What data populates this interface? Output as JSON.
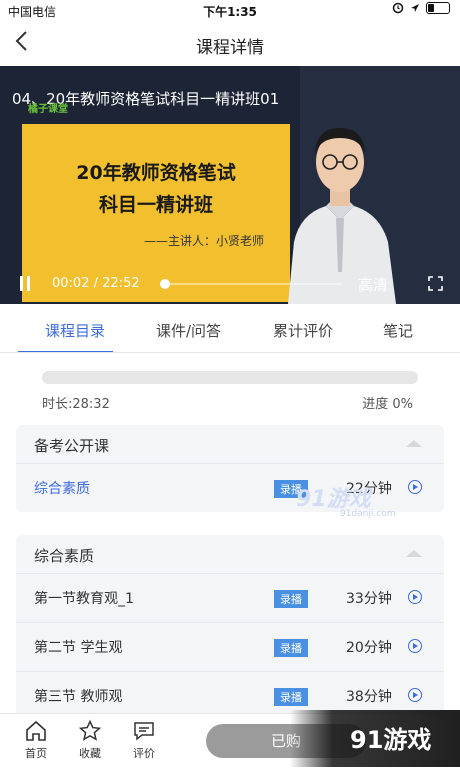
{
  "status_bar": {
    "carrier": "中国电信",
    "time": "下午1:35"
  },
  "nav": {
    "title": "课程详情"
  },
  "video": {
    "title": "04、20年教师资格笔试科目一精讲班01",
    "logo_text": "橘子课堂",
    "slide_line1": "20年教师资格笔试",
    "slide_line2": "科目一精讲班",
    "slide_speaker": "——主讲人：小贤老师",
    "current_time": "00:02",
    "separator": "/",
    "total_time": "22:52",
    "played_fraction": 0.015,
    "quality": "高清"
  },
  "tabs": [
    {
      "label": "课程目录",
      "active": true
    },
    {
      "label": "课件/问答"
    },
    {
      "label": "累计评价"
    },
    {
      "label": "笔记"
    }
  ],
  "progress": {
    "duration_text": "时长:28:32",
    "percent_text": "进度 0%",
    "value": 0
  },
  "sections": [
    {
      "name": "备考公开课",
      "rows": [
        {
          "title": "综合素质",
          "badge": "录播",
          "duration": "22分钟",
          "highlight": true
        }
      ]
    },
    {
      "name": "综合素质",
      "rows": [
        {
          "title": "第一节教育观_1",
          "badge": "录播",
          "duration": "33分钟"
        },
        {
          "title": "第二节 学生观",
          "badge": "录播",
          "duration": "20分钟"
        },
        {
          "title": "第三节 教师观",
          "badge": "录播",
          "duration": "38分钟"
        }
      ]
    }
  ],
  "watermark": {
    "main": "91游戏",
    "sub": "91danji.com",
    "bottom": "91游戏"
  },
  "bottom_nav": {
    "home": "首页",
    "favorite": "收藏",
    "review": "评价",
    "action_button": "已购"
  },
  "colors": {
    "accent": "#3d6ce0",
    "badge": "#4a90e2",
    "slide": "#f2c02f"
  }
}
